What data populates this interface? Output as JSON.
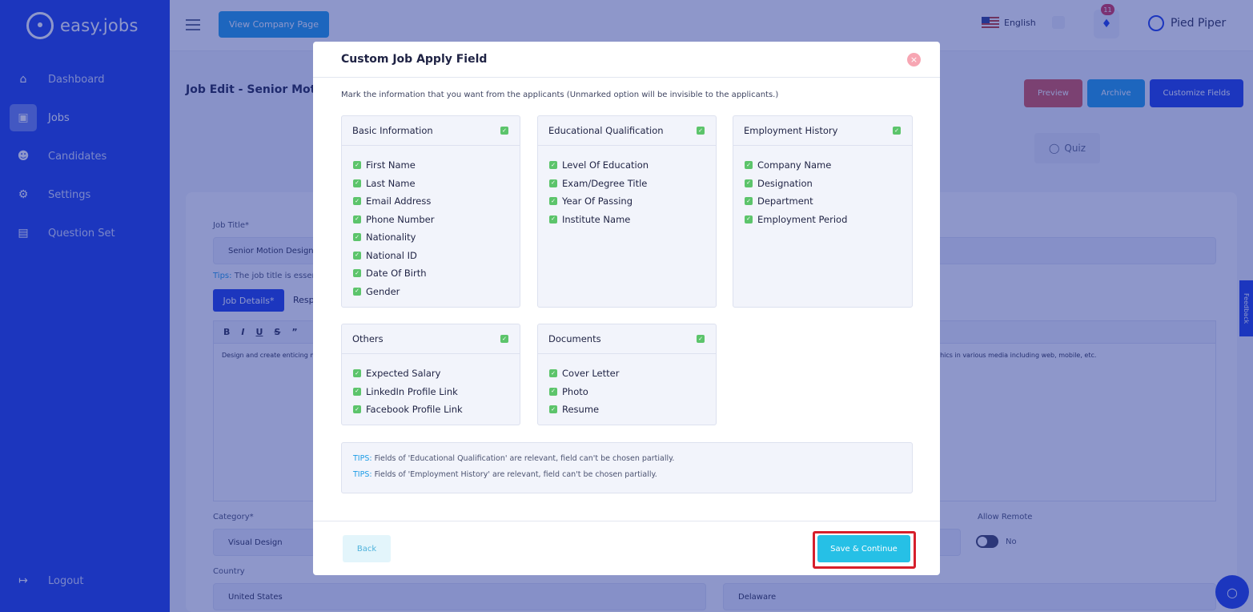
{
  "app": {
    "logo_text": "easy.jobs",
    "nav": [
      {
        "label": "Dashboard",
        "icon": "home-icon"
      },
      {
        "label": "Jobs",
        "icon": "briefcase-icon"
      },
      {
        "label": "Candidates",
        "icon": "users-icon"
      },
      {
        "label": "Settings",
        "icon": "gear-icon"
      },
      {
        "label": "Question Set",
        "icon": "document-icon"
      }
    ],
    "logout_label": "Logout",
    "view_company_label": "View Company Page",
    "language": "English",
    "notification_count": "11",
    "company_name": "Pied Piper"
  },
  "page": {
    "title": "Job Edit - Senior Motio",
    "buttons": {
      "preview": "Preview",
      "archive": "Archive",
      "customize": "Customize Fields"
    },
    "step_quiz": "Quiz",
    "job_title_label": "Job Title*",
    "job_title_value": "Senior Motion Designe",
    "tips_prefix": "Tips:",
    "tips_text": "The job title is essent",
    "tab_job_details": "Job Details*",
    "tab_resp": "Resp",
    "editor_text_left": "Design and create enticing m",
    "editor_text_right": "phics in various media including web, mobile, etc.",
    "category_label": "Category*",
    "category_value": "Visual Design",
    "allow_remote_label": "Allow Remote",
    "allow_remote_value": "No",
    "country_label": "Country",
    "country_value": "United States",
    "state_value": "Delaware",
    "feedback_label": "Feedback"
  },
  "modal": {
    "title": "Custom Job Apply Field",
    "description": "Mark the information that you want from the applicants (Unmarked option will be invisible to the applicants.)",
    "sections": {
      "basic": {
        "title": "Basic Information",
        "items": [
          "First Name",
          "Last Name",
          "Email Address",
          "Phone Number",
          "Nationality",
          "National ID",
          "Date Of Birth",
          "Gender"
        ]
      },
      "education": {
        "title": "Educational Qualification",
        "items": [
          "Level Of Education",
          "Exam/Degree Title",
          "Year Of Passing",
          "Institute Name"
        ]
      },
      "employment": {
        "title": "Employment History",
        "items": [
          "Company Name",
          "Designation",
          "Department",
          "Employment Period"
        ]
      },
      "others": {
        "title": "Others",
        "items": [
          "Expected Salary",
          "LinkedIn Profile Link",
          "Facebook Profile Link"
        ]
      },
      "documents": {
        "title": "Documents",
        "items": [
          "Cover Letter",
          "Photo",
          "Resume"
        ]
      }
    },
    "tips": [
      {
        "key": "TIPS:",
        "text": "Fields of 'Educational Qualification' are relevant, field can't be chosen partially."
      },
      {
        "key": "TIPS:",
        "text": "Fields of 'Employment History' are relevant, field can't be chosen partially."
      }
    ],
    "back_label": "Back",
    "save_label": "Save & Continue"
  },
  "colors": {
    "sidebar": "#1a3de6",
    "checkbox": "#5cc46b",
    "save_button": "#26c0e6",
    "highlight_outline": "#d61f2c",
    "close_button": "#f7a6b3"
  }
}
